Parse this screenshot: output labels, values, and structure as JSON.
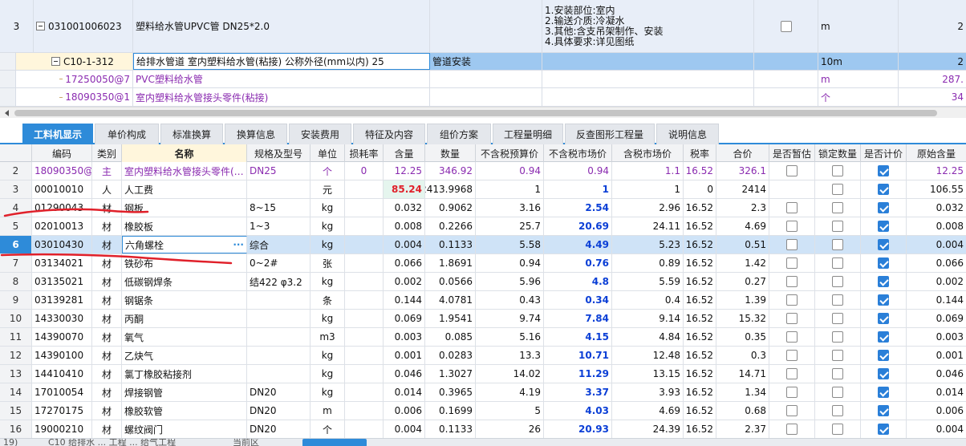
{
  "top_rows": [
    {
      "no": "3",
      "code": "031001006023",
      "name": "塑料给水管UPVC管 DN25*2.0",
      "feature_lines": [
        "1.安装部位:室内",
        "2.输送介质:冷凝水",
        "3.其他:含支吊架制作、安装",
        "4.具体要求:详见图纸"
      ],
      "unit": "m",
      "right_val": "2"
    },
    {
      "code": "C10-1-312",
      "name": "给排水管道 室内塑料给水管(粘接) 公称外径(mm以内) 25",
      "category": "管道安装",
      "unit": "10m",
      "right_val": "2"
    },
    {
      "code": "17250050@7",
      "name": "PVC塑料给水管",
      "unit": "m",
      "right_val": "287."
    },
    {
      "code": "18090350@1",
      "name": "室内塑料给水管接头零件(粘接)",
      "unit": "个",
      "right_val": "34"
    }
  ],
  "tabs": [
    "工料机显示",
    "单价构成",
    "标准换算",
    "换算信息",
    "安装费用",
    "特征及内容",
    "组价方案",
    "工程量明细",
    "反查图形工程量",
    "说明信息"
  ],
  "columns": [
    "编码",
    "类别",
    "名称",
    "规格及型号",
    "单位",
    "损耗率",
    "含量",
    "数量",
    "不含税预算价",
    "不含税市场价",
    "含税市场价",
    "税率",
    "合价",
    "是否暂估",
    "锁定数量",
    "是否计价",
    "原始含量"
  ],
  "rows": [
    {
      "n": "2",
      "code": "18090350@1",
      "type": "主",
      "name": "室内塑料给水管接头零件(…",
      "spec": "DN25",
      "unit": "个",
      "loss": "0",
      "amt": "12.25",
      "qty": "346.92",
      "pre": "0.94",
      "mkt": "0.94",
      "taxmkt": "1.1",
      "rate": "16.52",
      "total": "326.1",
      "est": false,
      "lock": false,
      "price": true,
      "orig": "12.25"
    },
    {
      "n": "3",
      "code": "00010010",
      "type": "人",
      "name": "人工费",
      "spec": "",
      "unit": "元",
      "loss": "",
      "amt": "85.24",
      "qty": "2413.9968",
      "pre": "1",
      "mkt": "1",
      "taxmkt": "1",
      "rate": "0",
      "total": "2414",
      "est": null,
      "lock": false,
      "price": true,
      "orig": "106.55"
    },
    {
      "n": "4",
      "code": "01290043",
      "type": "材",
      "name": "钢板",
      "spec": "8~15",
      "unit": "kg",
      "loss": "",
      "amt": "0.032",
      "qty": "0.9062",
      "pre": "3.16",
      "mkt": "2.54",
      "taxmkt": "2.96",
      "rate": "16.52",
      "total": "2.3",
      "est": false,
      "lock": false,
      "price": true,
      "orig": "0.032"
    },
    {
      "n": "5",
      "code": "02010013",
      "type": "材",
      "name": "橡胶板",
      "spec": "1~3",
      "unit": "kg",
      "loss": "",
      "amt": "0.008",
      "qty": "0.2266",
      "pre": "25.7",
      "mkt": "20.69",
      "taxmkt": "24.11",
      "rate": "16.52",
      "total": "4.69",
      "est": false,
      "lock": false,
      "price": true,
      "orig": "0.008"
    },
    {
      "n": "6",
      "code": "03010430",
      "type": "材",
      "name": "六角螺栓",
      "spec": "综合",
      "unit": "kg",
      "loss": "",
      "amt": "0.004",
      "qty": "0.1133",
      "pre": "5.58",
      "mkt": "4.49",
      "taxmkt": "5.23",
      "rate": "16.52",
      "total": "0.51",
      "est": false,
      "lock": false,
      "price": true,
      "orig": "0.004",
      "sel": true
    },
    {
      "n": "7",
      "code": "03134021",
      "type": "材",
      "name": "铁砂布",
      "spec": "0~2#",
      "unit": "张",
      "loss": "",
      "amt": "0.066",
      "qty": "1.8691",
      "pre": "0.94",
      "mkt": "0.76",
      "taxmkt": "0.89",
      "rate": "16.52",
      "total": "1.42",
      "est": false,
      "lock": false,
      "price": true,
      "orig": "0.066"
    },
    {
      "n": "8",
      "code": "03135021",
      "type": "材",
      "name": "低碳钢焊条",
      "spec": "结422 φ3.2",
      "unit": "kg",
      "loss": "",
      "amt": "0.002",
      "qty": "0.0566",
      "pre": "5.96",
      "mkt": "4.8",
      "taxmkt": "5.59",
      "rate": "16.52",
      "total": "0.27",
      "est": false,
      "lock": false,
      "price": true,
      "orig": "0.002"
    },
    {
      "n": "9",
      "code": "03139281",
      "type": "材",
      "name": "钢锯条",
      "spec": "",
      "unit": "条",
      "loss": "",
      "amt": "0.144",
      "qty": "4.0781",
      "pre": "0.43",
      "mkt": "0.34",
      "taxmkt": "0.4",
      "rate": "16.52",
      "total": "1.39",
      "est": false,
      "lock": false,
      "price": true,
      "orig": "0.144"
    },
    {
      "n": "10",
      "code": "14330030",
      "type": "材",
      "name": "丙酮",
      "spec": "",
      "unit": "kg",
      "loss": "",
      "amt": "0.069",
      "qty": "1.9541",
      "pre": "9.74",
      "mkt": "7.84",
      "taxmkt": "9.14",
      "rate": "16.52",
      "total": "15.32",
      "est": false,
      "lock": false,
      "price": true,
      "orig": "0.069"
    },
    {
      "n": "11",
      "code": "14390070",
      "type": "材",
      "name": "氧气",
      "spec": "",
      "unit": "m3",
      "loss": "",
      "amt": "0.003",
      "qty": "0.085",
      "pre": "5.16",
      "mkt": "4.15",
      "taxmkt": "4.84",
      "rate": "16.52",
      "total": "0.35",
      "est": false,
      "lock": false,
      "price": true,
      "orig": "0.003"
    },
    {
      "n": "12",
      "code": "14390100",
      "type": "材",
      "name": "乙炔气",
      "spec": "",
      "unit": "kg",
      "loss": "",
      "amt": "0.001",
      "qty": "0.0283",
      "pre": "13.3",
      "mkt": "10.71",
      "taxmkt": "12.48",
      "rate": "16.52",
      "total": "0.3",
      "est": false,
      "lock": false,
      "price": true,
      "orig": "0.001"
    },
    {
      "n": "13",
      "code": "14410410",
      "type": "材",
      "name": "氯丁橡胶粘接剂",
      "spec": "",
      "unit": "kg",
      "loss": "",
      "amt": "0.046",
      "qty": "1.3027",
      "pre": "14.02",
      "mkt": "11.29",
      "taxmkt": "13.15",
      "rate": "16.52",
      "total": "14.71",
      "est": false,
      "lock": false,
      "price": true,
      "orig": "0.046"
    },
    {
      "n": "14",
      "code": "17010054",
      "type": "材",
      "name": "焊接钢管",
      "spec": "DN20",
      "unit": "kg",
      "loss": "",
      "amt": "0.014",
      "qty": "0.3965",
      "pre": "4.19",
      "mkt": "3.37",
      "taxmkt": "3.93",
      "rate": "16.52",
      "total": "1.34",
      "est": false,
      "lock": false,
      "price": true,
      "orig": "0.014"
    },
    {
      "n": "15",
      "code": "17270175",
      "type": "材",
      "name": "橡胶软管",
      "spec": "DN20",
      "unit": "m",
      "loss": "",
      "amt": "0.006",
      "qty": "0.1699",
      "pre": "5",
      "mkt": "4.03",
      "taxmkt": "4.69",
      "rate": "16.52",
      "total": "0.68",
      "est": false,
      "lock": false,
      "price": true,
      "orig": "0.006"
    },
    {
      "n": "16",
      "code": "19000210",
      "type": "材",
      "name": "螺纹阀门",
      "spec": "DN20",
      "unit": "个",
      "loss": "",
      "amt": "0.004",
      "qty": "0.1133",
      "pre": "26",
      "mkt": "20.93",
      "taxmkt": "24.39",
      "rate": "16.52",
      "total": "2.37",
      "est": false,
      "lock": false,
      "price": true,
      "orig": "0.004"
    }
  ],
  "status": {
    "left": "19)",
    "mid": "C10 给排水 ... 工程 ... 给气工程",
    "right": "当前区"
  },
  "colors": {
    "accent": "#2e8bd9",
    "purple": "#8a2bb0",
    "blue": "#0b3fd6",
    "red": "#e0202a",
    "annotation": "#e0202a"
  }
}
